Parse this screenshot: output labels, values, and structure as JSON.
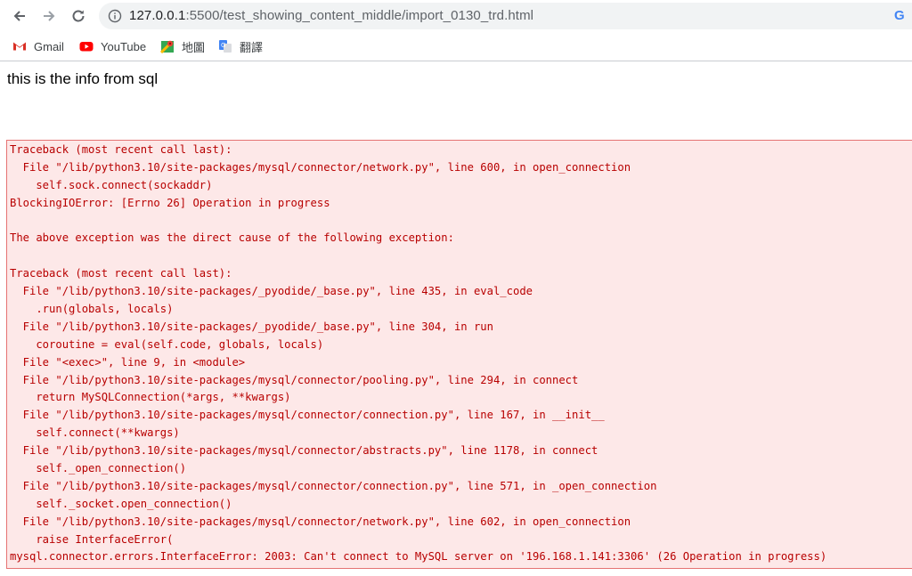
{
  "browser": {
    "url_host": "127.0.0.1",
    "url_path": ":5500/test_showing_content_middle/import_0130_trd.html",
    "bookmarks": [
      {
        "label": "Gmail",
        "icon": "gmail-icon"
      },
      {
        "label": "YouTube",
        "icon": "youtube-icon"
      },
      {
        "label": "地圖",
        "icon": "maps-icon"
      },
      {
        "label": "翻譯",
        "icon": "translate-icon"
      }
    ]
  },
  "page": {
    "heading": "this is the info from sql",
    "error_lines": [
      "Traceback (most recent call last):",
      "  File \"/lib/python3.10/site-packages/mysql/connector/network.py\", line 600, in open_connection",
      "    self.sock.connect(sockaddr)",
      "BlockingIOError: [Errno 26] Operation in progress",
      "",
      "The above exception was the direct cause of the following exception:",
      "",
      "Traceback (most recent call last):",
      "  File \"/lib/python3.10/site-packages/_pyodide/_base.py\", line 435, in eval_code",
      "    .run(globals, locals)",
      "  File \"/lib/python3.10/site-packages/_pyodide/_base.py\", line 304, in run",
      "    coroutine = eval(self.code, globals, locals)",
      "  File \"<exec>\", line 9, in <module>",
      "  File \"/lib/python3.10/site-packages/mysql/connector/pooling.py\", line 294, in connect",
      "    return MySQLConnection(*args, **kwargs)",
      "  File \"/lib/python3.10/site-packages/mysql/connector/connection.py\", line 167, in __init__",
      "    self.connect(**kwargs)",
      "  File \"/lib/python3.10/site-packages/mysql/connector/abstracts.py\", line 1178, in connect",
      "    self._open_connection()",
      "  File \"/lib/python3.10/site-packages/mysql/connector/connection.py\", line 571, in _open_connection",
      "    self._socket.open_connection()",
      "  File \"/lib/python3.10/site-packages/mysql/connector/network.py\", line 602, in open_connection",
      "    raise InterfaceError(",
      "mysql.connector.errors.InterfaceError: 2003: Can't connect to MySQL server on '196.168.1.141:3306' (26 Operation in progress)"
    ]
  },
  "colors": {
    "error_text": "#b80000",
    "error_bg": "#fde8e8",
    "error_border": "#e57373"
  }
}
